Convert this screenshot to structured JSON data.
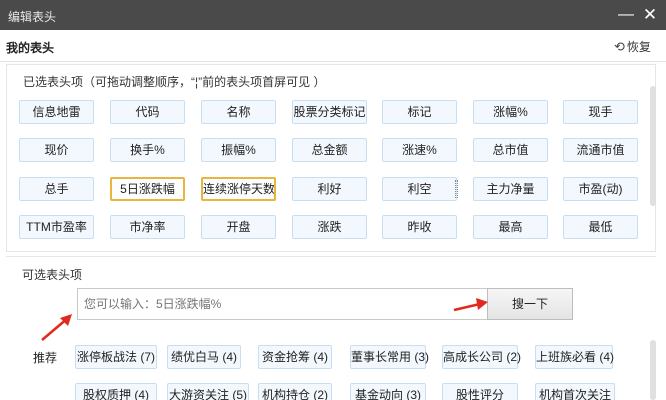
{
  "window": {
    "title": "编辑表头",
    "minimize": "—",
    "close": "✕"
  },
  "header": {
    "title": "我的表头",
    "restore_label": "恢复",
    "restore_icon": "refresh-icon"
  },
  "selected": {
    "hint": "已选表头项（可拖动调整顺序，“¦”前的表头项首屏可见 ）",
    "items": [
      "信息地雷",
      "代码",
      "名称",
      "股票分类标记",
      "标记",
      "涨幅%",
      "现手",
      "现价",
      "换手%",
      "振幅%",
      "总金额",
      "涨速%",
      "总市值",
      "流通市值",
      "总手",
      "5日涨跌幅",
      "连续涨停天数",
      "利好",
      "利空",
      "主力净量",
      "市盈(动)",
      "TTM市盈率",
      "市净率",
      "开盘",
      "涨跌",
      "昨收",
      "最高",
      "最低"
    ]
  },
  "optional": {
    "hint": "可选表头项",
    "search_placeholder": "您可以输入：5日涨跌幅%",
    "search_button": "搜一下",
    "recommend_label": "推荐",
    "recommend": [
      "涨停板战法 (7)",
      "绩优白马 (4)",
      "资金抢筹 (4)",
      "董事长常用 (3)",
      "高成长公司 (2)",
      "上班族必看 (4)",
      "股权质押 (4)",
      "大游资关注 (5)",
      "机构持仓 (2)",
      "基金动向 (3)",
      "股性评分",
      "机构首次关注"
    ]
  },
  "colors": {
    "titlebar": "#4a4a4a",
    "chip_border": "#c8dff2",
    "chip_bg": "#f2f8fd",
    "highlight": "#e8b63a",
    "arrow": "#e02a1e"
  }
}
